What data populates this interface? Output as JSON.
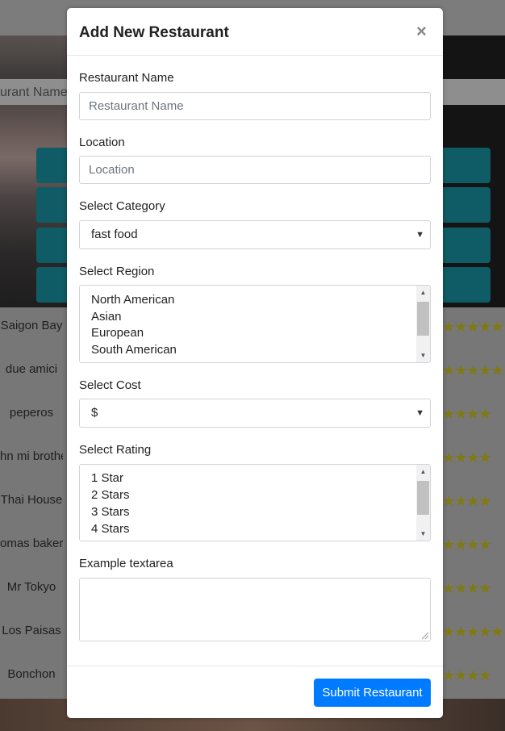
{
  "background": {
    "search_placeholder": "urant Name",
    "restaurants": [
      {
        "name": "Saigon Bay",
        "stars": "★★★★★"
      },
      {
        "name": "due amici",
        "stars": "★★★★★"
      },
      {
        "name": "peperos",
        "stars": "★★★★"
      },
      {
        "name": "hn mi brothe",
        "stars": "★★★★"
      },
      {
        "name": "Thai House",
        "stars": "★★★★"
      },
      {
        "name": "omas bakery",
        "stars": "★★★★"
      },
      {
        "name": "Mr Tokyo",
        "stars": "★★★★"
      },
      {
        "name": "Los Paisas",
        "stars": "★★★★★"
      },
      {
        "name": "Bonchon",
        "stars": "★★★★"
      }
    ],
    "colors": {
      "accent_button": "#0f5c66",
      "star": "#7f7a12"
    }
  },
  "modal": {
    "title": "Add New Restaurant",
    "close_label": "×",
    "fields": {
      "name_label": "Restaurant Name",
      "name_placeholder": "Restaurant Name",
      "location_label": "Location",
      "location_placeholder": "Location",
      "category_label": "Select Category",
      "category_value": "fast food",
      "region_label": "Select Region",
      "region_options": [
        "North American",
        "Asian",
        "European",
        "South American"
      ],
      "cost_label": "Select Cost",
      "cost_value": "$",
      "rating_label": "Select Rating",
      "rating_options": [
        "1 Star",
        "2 Stars",
        "3 Stars",
        "4 Stars"
      ],
      "textarea_label": "Example textarea",
      "textarea_value": ""
    },
    "submit_label": "Submit Restaurant",
    "colors": {
      "primary": "#007bff"
    },
    "icons": {
      "select_arrow": "caret-down-icon",
      "scroll_up": "scroll-up-icon",
      "scroll_down": "scroll-down-icon",
      "close": "close-icon"
    }
  }
}
